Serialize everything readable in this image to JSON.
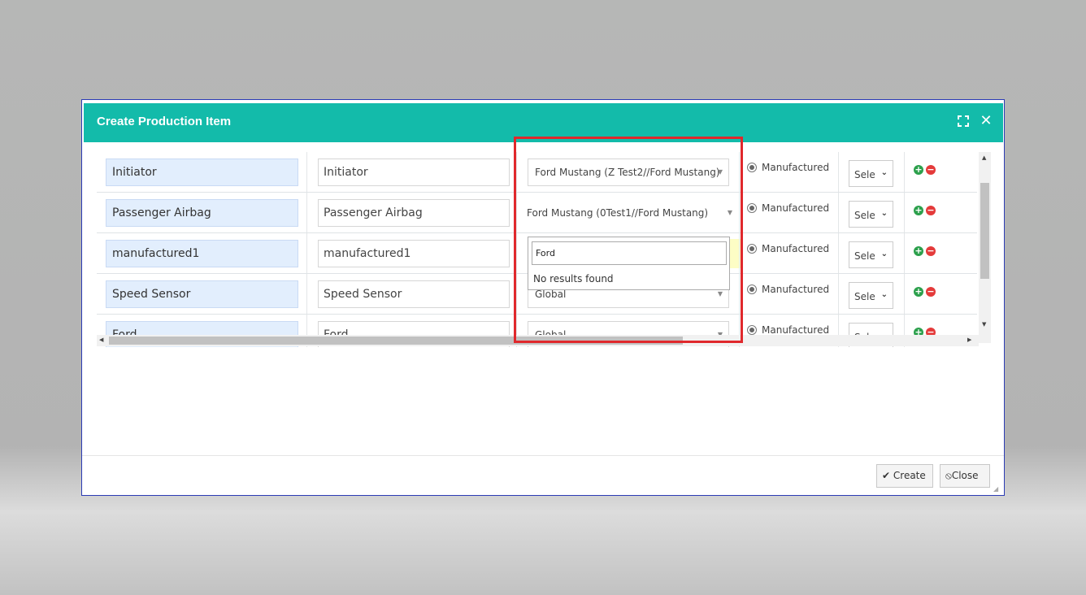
{
  "modal": {
    "title": "Create Production Item",
    "expand_icon": "expand-icon",
    "close_icon": "close-icon",
    "close_glyph": "✕"
  },
  "rows": [
    {
      "name": "Initiator",
      "description": "Initiator",
      "model": "Ford Mustang (Z Test2//Ford Mustang)",
      "type": "Manufactured",
      "select": "Sele"
    },
    {
      "name": "Passenger Airbag",
      "description": "Passenger Airbag",
      "model": "Ford Mustang (0Test1//Ford Mustang)",
      "type": "Manufactured",
      "select": "Sele"
    },
    {
      "name": "manufactured1",
      "description": "manufactured1",
      "model": "",
      "type": "Manufactured",
      "select": "Sele"
    },
    {
      "name": "Speed Sensor",
      "description": "Speed Sensor",
      "model": "Global",
      "type": "Manufactured",
      "select": "Sele"
    },
    {
      "name": "Ford",
      "description": "Ford",
      "model": "Global",
      "type": "Manufactured",
      "select": "Sele"
    }
  ],
  "dropdown": {
    "search_value": "Ford",
    "message": "No results found"
  },
  "footer": {
    "create_label": "Create",
    "close_label": "Close"
  },
  "colors": {
    "header": "#13bbaa",
    "callout_border": "#e0282c",
    "add": "#2ca04c",
    "remove": "#e43a3a"
  }
}
